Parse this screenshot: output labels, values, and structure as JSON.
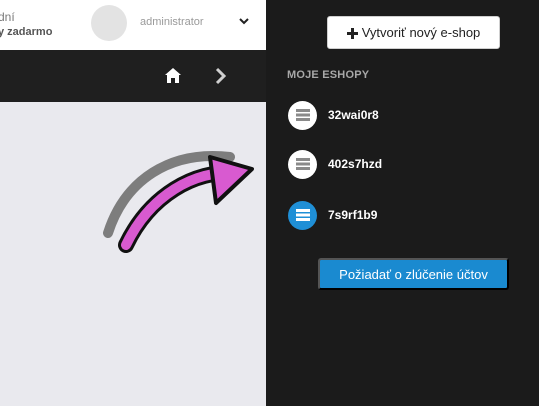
{
  "header": {
    "trial_line1": "dní",
    "trial_line2": "y zadarmo",
    "user_name": "administrator"
  },
  "nav": {
    "home_icon": "home-icon",
    "next_icon": "chevron-right-icon"
  },
  "panel": {
    "create_button": "Vytvoriť nový e-shop",
    "section_title": "MOJE ESHOPY",
    "shops": [
      {
        "name": "32wai0r8",
        "active": false
      },
      {
        "name": "402s7hzd",
        "active": false
      },
      {
        "name": "7s9rf1b9",
        "active": true
      }
    ],
    "merge_button": "Požiadať o zlúčenie účtov"
  },
  "colors": {
    "accent": "#1a8ad0",
    "panel_bg": "#1b1b1b",
    "arrow_fill": "#d85ad0"
  }
}
